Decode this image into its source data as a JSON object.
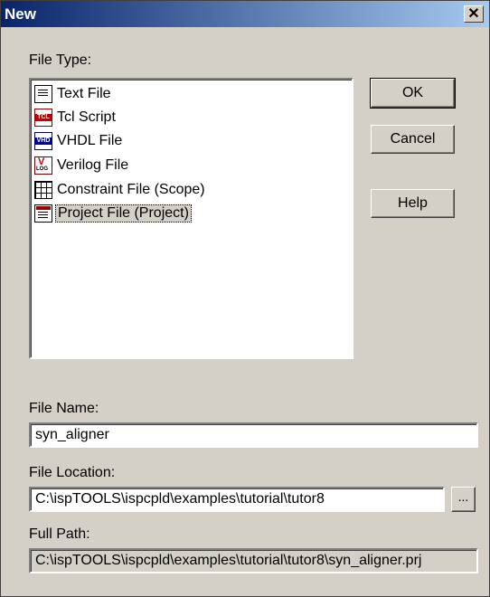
{
  "window": {
    "title": "New",
    "close_glyph": "✕"
  },
  "file_type": {
    "label": "File Type:",
    "items": [
      {
        "label": "Text File",
        "icon": "text-file-icon"
      },
      {
        "label": "Tcl Script",
        "icon": "tcl-script-icon",
        "badge": "TCL"
      },
      {
        "label": "VHDL File",
        "icon": "vhdl-file-icon",
        "badge": "VHD"
      },
      {
        "label": "Verilog File",
        "icon": "verilog-file-icon"
      },
      {
        "label": "Constraint File (Scope)",
        "icon": "constraint-grid-icon"
      },
      {
        "label": "Project File (Project)",
        "icon": "project-file-icon",
        "selected": true
      }
    ]
  },
  "buttons": {
    "ok": "OK",
    "cancel": "Cancel",
    "help": "Help",
    "browse": "..."
  },
  "file_name": {
    "label": "File Name:",
    "value": "syn_aligner"
  },
  "file_location": {
    "label": "File Location:",
    "value": "C:\\ispTOOLS\\ispcpld\\examples\\tutorial\\tutor8"
  },
  "full_path": {
    "label": "Full Path:",
    "value": "C:\\ispTOOLS\\ispcpld\\examples\\tutorial\\tutor8\\syn_aligner.prj"
  },
  "colors": {
    "title_start": "#0a246a",
    "title_end": "#a6caf0",
    "face": "#d4d0c8"
  }
}
